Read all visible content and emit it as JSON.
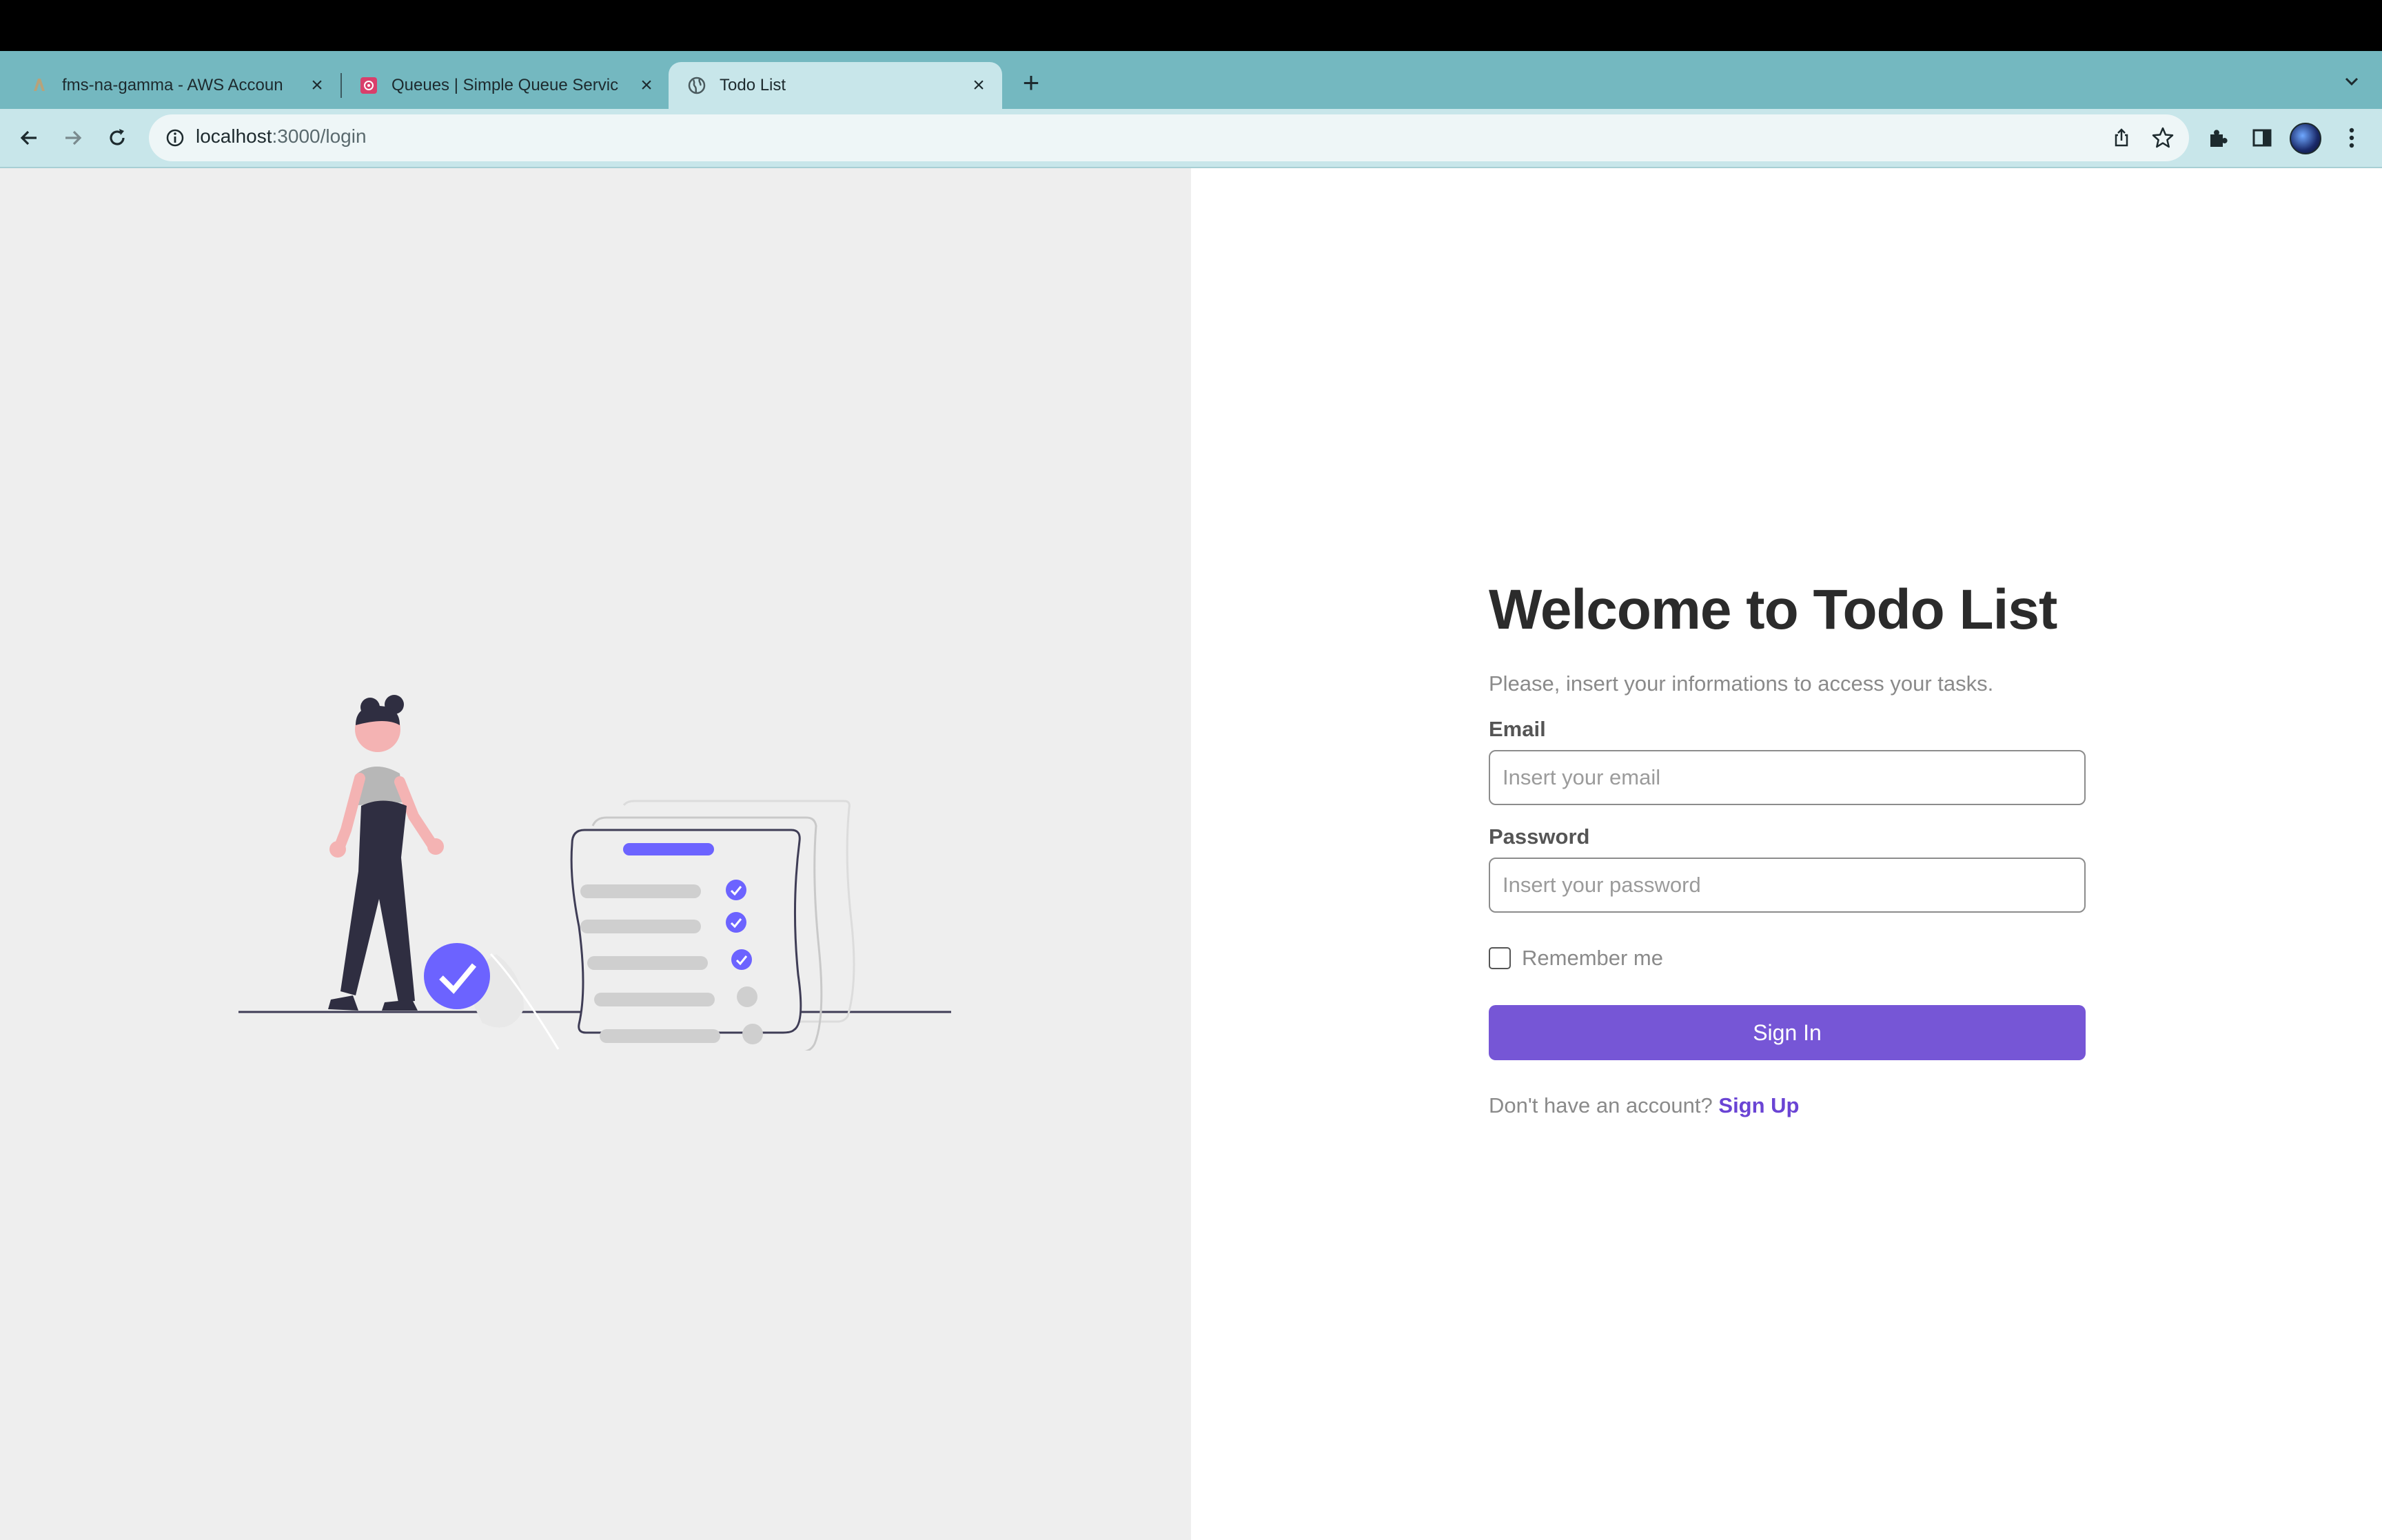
{
  "browser": {
    "tabs": [
      {
        "title": "fms-na-gamma - AWS Accoun",
        "icon": "aws-account-icon",
        "close": "×"
      },
      {
        "title": "Queues | Simple Queue Servic",
        "icon": "sqs-icon",
        "close": "×"
      },
      {
        "title": "Todo List",
        "icon": "globe-icon",
        "close": "×",
        "active": true
      }
    ],
    "new_tab": "+",
    "url_host": "localhost",
    "url_path": ":3000/login"
  },
  "login": {
    "title": "Welcome to Todo List",
    "subtitle": "Please, insert your informations to access your tasks.",
    "email_label": "Email",
    "email_placeholder": "Insert your email",
    "password_label": "Password",
    "password_placeholder": "Insert your password",
    "remember_label": "Remember me",
    "remember_checked": false,
    "signin_label": "Sign In",
    "signup_prompt": "Don't have an account?",
    "signup_link": "Sign Up"
  },
  "colors": {
    "accent": "#7656d6",
    "link": "#6a44d4",
    "tab_strip": "#74b8c0",
    "toolbar": "#c8e6ea",
    "left_panel": "#eeeeee"
  }
}
